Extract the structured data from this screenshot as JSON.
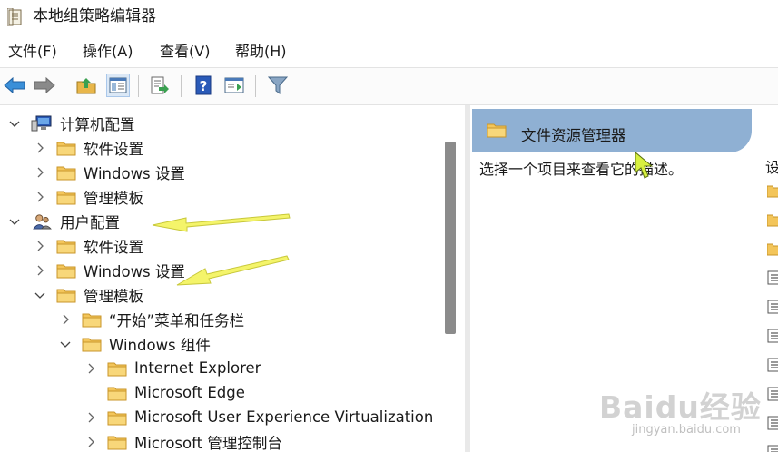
{
  "window": {
    "title": "本地组策略编辑器"
  },
  "menu": [
    "文件(F)",
    "操作(A)",
    "查看(V)",
    "帮助(H)"
  ],
  "toolbar": {
    "icons": [
      "back-arrow-icon",
      "forward-arrow-icon",
      "up-folder-icon",
      "show-hide-tree-icon",
      "export-list-icon",
      "help-icon",
      "extended-view-icon",
      "filter-icon"
    ]
  },
  "tree": {
    "computer_config": "计算机配置",
    "cc_software": "软件设置",
    "cc_windows": "Windows 设置",
    "cc_admin": "管理模板",
    "user_config": "用户配置",
    "uc_software": "软件设置",
    "uc_windows": "Windows 设置",
    "uc_admin": "管理模板",
    "start_menu": "“开始”菜单和任务栏",
    "win_components": "Windows 组件",
    "ie": "Internet Explorer",
    "edge": "Microsoft Edge",
    "uev": "Microsoft User Experience Virtualization",
    "mmc": "Microsoft 管理控制台"
  },
  "right_pane": {
    "header": "文件资源管理器",
    "description": "选择一个项目来查看它的描述。",
    "column_peek": "设"
  },
  "watermark": {
    "main": "Baidu经验",
    "sub": "jingyan.baidu.com"
  },
  "colors": {
    "header_bg": "#8fb0d3",
    "folder": "#f3c55a",
    "annotation_arrow": "#f3f36a"
  }
}
